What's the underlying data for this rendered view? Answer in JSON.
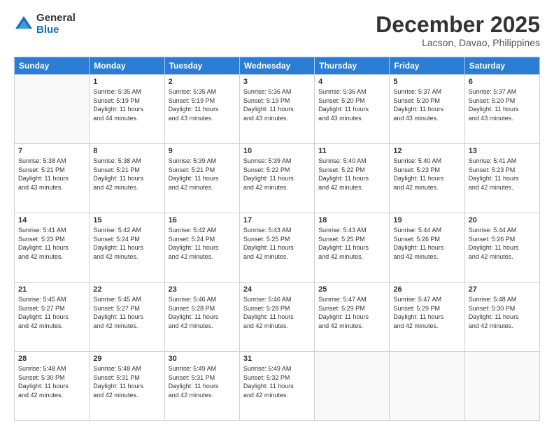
{
  "logo": {
    "general": "General",
    "blue": "Blue"
  },
  "header": {
    "month": "December 2025",
    "location": "Lacson, Davao, Philippines"
  },
  "days_of_week": [
    "Sunday",
    "Monday",
    "Tuesday",
    "Wednesday",
    "Thursday",
    "Friday",
    "Saturday"
  ],
  "weeks": [
    [
      {
        "day": "",
        "info": ""
      },
      {
        "day": "1",
        "info": "Sunrise: 5:35 AM\nSunset: 5:19 PM\nDaylight: 11 hours\nand 44 minutes."
      },
      {
        "day": "2",
        "info": "Sunrise: 5:35 AM\nSunset: 5:19 PM\nDaylight: 11 hours\nand 43 minutes."
      },
      {
        "day": "3",
        "info": "Sunrise: 5:36 AM\nSunset: 5:19 PM\nDaylight: 11 hours\nand 43 minutes."
      },
      {
        "day": "4",
        "info": "Sunrise: 5:36 AM\nSunset: 5:20 PM\nDaylight: 11 hours\nand 43 minutes."
      },
      {
        "day": "5",
        "info": "Sunrise: 5:37 AM\nSunset: 5:20 PM\nDaylight: 11 hours\nand 43 minutes."
      },
      {
        "day": "6",
        "info": "Sunrise: 5:37 AM\nSunset: 5:20 PM\nDaylight: 11 hours\nand 43 minutes."
      }
    ],
    [
      {
        "day": "7",
        "info": "Sunrise: 5:38 AM\nSunset: 5:21 PM\nDaylight: 11 hours\nand 43 minutes."
      },
      {
        "day": "8",
        "info": "Sunrise: 5:38 AM\nSunset: 5:21 PM\nDaylight: 11 hours\nand 42 minutes."
      },
      {
        "day": "9",
        "info": "Sunrise: 5:39 AM\nSunset: 5:21 PM\nDaylight: 11 hours\nand 42 minutes."
      },
      {
        "day": "10",
        "info": "Sunrise: 5:39 AM\nSunset: 5:22 PM\nDaylight: 11 hours\nand 42 minutes."
      },
      {
        "day": "11",
        "info": "Sunrise: 5:40 AM\nSunset: 5:22 PM\nDaylight: 11 hours\nand 42 minutes."
      },
      {
        "day": "12",
        "info": "Sunrise: 5:40 AM\nSunset: 5:23 PM\nDaylight: 11 hours\nand 42 minutes."
      },
      {
        "day": "13",
        "info": "Sunrise: 5:41 AM\nSunset: 5:23 PM\nDaylight: 11 hours\nand 42 minutes."
      }
    ],
    [
      {
        "day": "14",
        "info": "Sunrise: 5:41 AM\nSunset: 5:23 PM\nDaylight: 11 hours\nand 42 minutes."
      },
      {
        "day": "15",
        "info": "Sunrise: 5:42 AM\nSunset: 5:24 PM\nDaylight: 11 hours\nand 42 minutes."
      },
      {
        "day": "16",
        "info": "Sunrise: 5:42 AM\nSunset: 5:24 PM\nDaylight: 11 hours\nand 42 minutes."
      },
      {
        "day": "17",
        "info": "Sunrise: 5:43 AM\nSunset: 5:25 PM\nDaylight: 11 hours\nand 42 minutes."
      },
      {
        "day": "18",
        "info": "Sunrise: 5:43 AM\nSunset: 5:25 PM\nDaylight: 11 hours\nand 42 minutes."
      },
      {
        "day": "19",
        "info": "Sunrise: 5:44 AM\nSunset: 5:26 PM\nDaylight: 11 hours\nand 42 minutes."
      },
      {
        "day": "20",
        "info": "Sunrise: 5:44 AM\nSunset: 5:26 PM\nDaylight: 11 hours\nand 42 minutes."
      }
    ],
    [
      {
        "day": "21",
        "info": "Sunrise: 5:45 AM\nSunset: 5:27 PM\nDaylight: 11 hours\nand 42 minutes."
      },
      {
        "day": "22",
        "info": "Sunrise: 5:45 AM\nSunset: 5:27 PM\nDaylight: 11 hours\nand 42 minutes."
      },
      {
        "day": "23",
        "info": "Sunrise: 5:46 AM\nSunset: 5:28 PM\nDaylight: 11 hours\nand 42 minutes."
      },
      {
        "day": "24",
        "info": "Sunrise: 5:46 AM\nSunset: 5:28 PM\nDaylight: 11 hours\nand 42 minutes."
      },
      {
        "day": "25",
        "info": "Sunrise: 5:47 AM\nSunset: 5:29 PM\nDaylight: 11 hours\nand 42 minutes."
      },
      {
        "day": "26",
        "info": "Sunrise: 5:47 AM\nSunset: 5:29 PM\nDaylight: 11 hours\nand 42 minutes."
      },
      {
        "day": "27",
        "info": "Sunrise: 5:48 AM\nSunset: 5:30 PM\nDaylight: 11 hours\nand 42 minutes."
      }
    ],
    [
      {
        "day": "28",
        "info": "Sunrise: 5:48 AM\nSunset: 5:30 PM\nDaylight: 11 hours\nand 42 minutes."
      },
      {
        "day": "29",
        "info": "Sunrise: 5:48 AM\nSunset: 5:31 PM\nDaylight: 11 hours\nand 42 minutes."
      },
      {
        "day": "30",
        "info": "Sunrise: 5:49 AM\nSunset: 5:31 PM\nDaylight: 11 hours\nand 42 minutes."
      },
      {
        "day": "31",
        "info": "Sunrise: 5:49 AM\nSunset: 5:32 PM\nDaylight: 11 hours\nand 42 minutes."
      },
      {
        "day": "",
        "info": ""
      },
      {
        "day": "",
        "info": ""
      },
      {
        "day": "",
        "info": ""
      }
    ]
  ]
}
